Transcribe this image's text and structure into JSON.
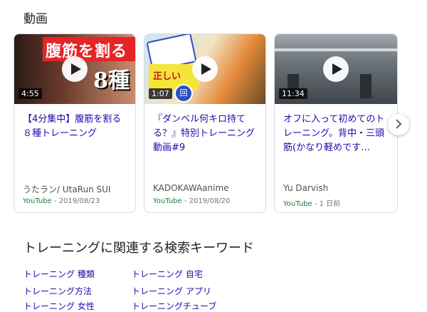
{
  "section_title": "動画",
  "cards": [
    {
      "thumb_text": "腹筋を割る",
      "thumb_num": "8種",
      "duration": "4:55",
      "title": "【4分集中】腹筋を割る８種トレーニング",
      "channel": "うたラン/ UtaRun SUI",
      "source": "YouTube",
      "date": " - 2019/08/23"
    },
    {
      "thumb_text": "正しい",
      "thumb_timer": "回",
      "duration": "1:07",
      "title": "『ダンベル何キロ持てる？』特別トレーニング動画#9",
      "channel": "KADOKAWAanime",
      "source": "YouTube",
      "date": " - 2019/08/20"
    },
    {
      "duration": "11:34",
      "title": "オフに入って初めてのトレーニング。背中・三頭筋(かなり軽めです…",
      "channel": "Yu Darvish",
      "source": "YouTube",
      "date": " - 1 日前"
    }
  ],
  "related": {
    "title": "トレーニングに関連する検索キーワード",
    "keywords_left": [
      "トレーニング 種類",
      "トレーニング方法",
      "トレーニング 女性"
    ],
    "keywords_right": [
      "トレーニング 自宅",
      "トレーニング アプリ",
      "トレーニングチューブ"
    ]
  },
  "colors": {
    "link": "#1a0dab",
    "source_green": "#188038",
    "border": "#dadce0"
  },
  "icons": {
    "play": "play-icon",
    "next": "chevron-right-icon"
  }
}
